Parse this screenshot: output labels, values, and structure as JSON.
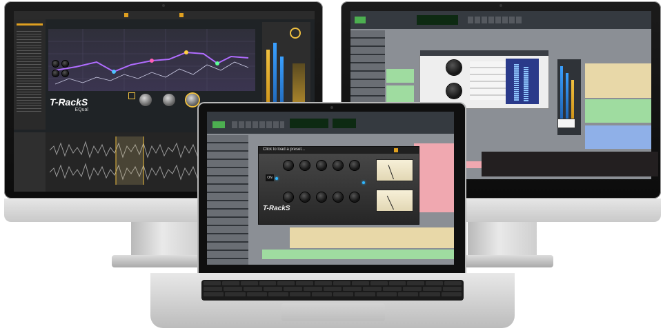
{
  "scene": "computer-setup",
  "left_monitor": {
    "brand_logo": "T-RackS",
    "plugin_name": "EQual"
  },
  "laptop": {
    "preset_prompt": "Click to load a preset...",
    "brand_logo": "T-RackS",
    "power_label": "ON"
  },
  "colors": {
    "eq_curve": "#b06cff",
    "meter_yellow": "#f0c040",
    "meter_blue": "#3aa0ff",
    "led_blue": "#2fb7ff"
  }
}
